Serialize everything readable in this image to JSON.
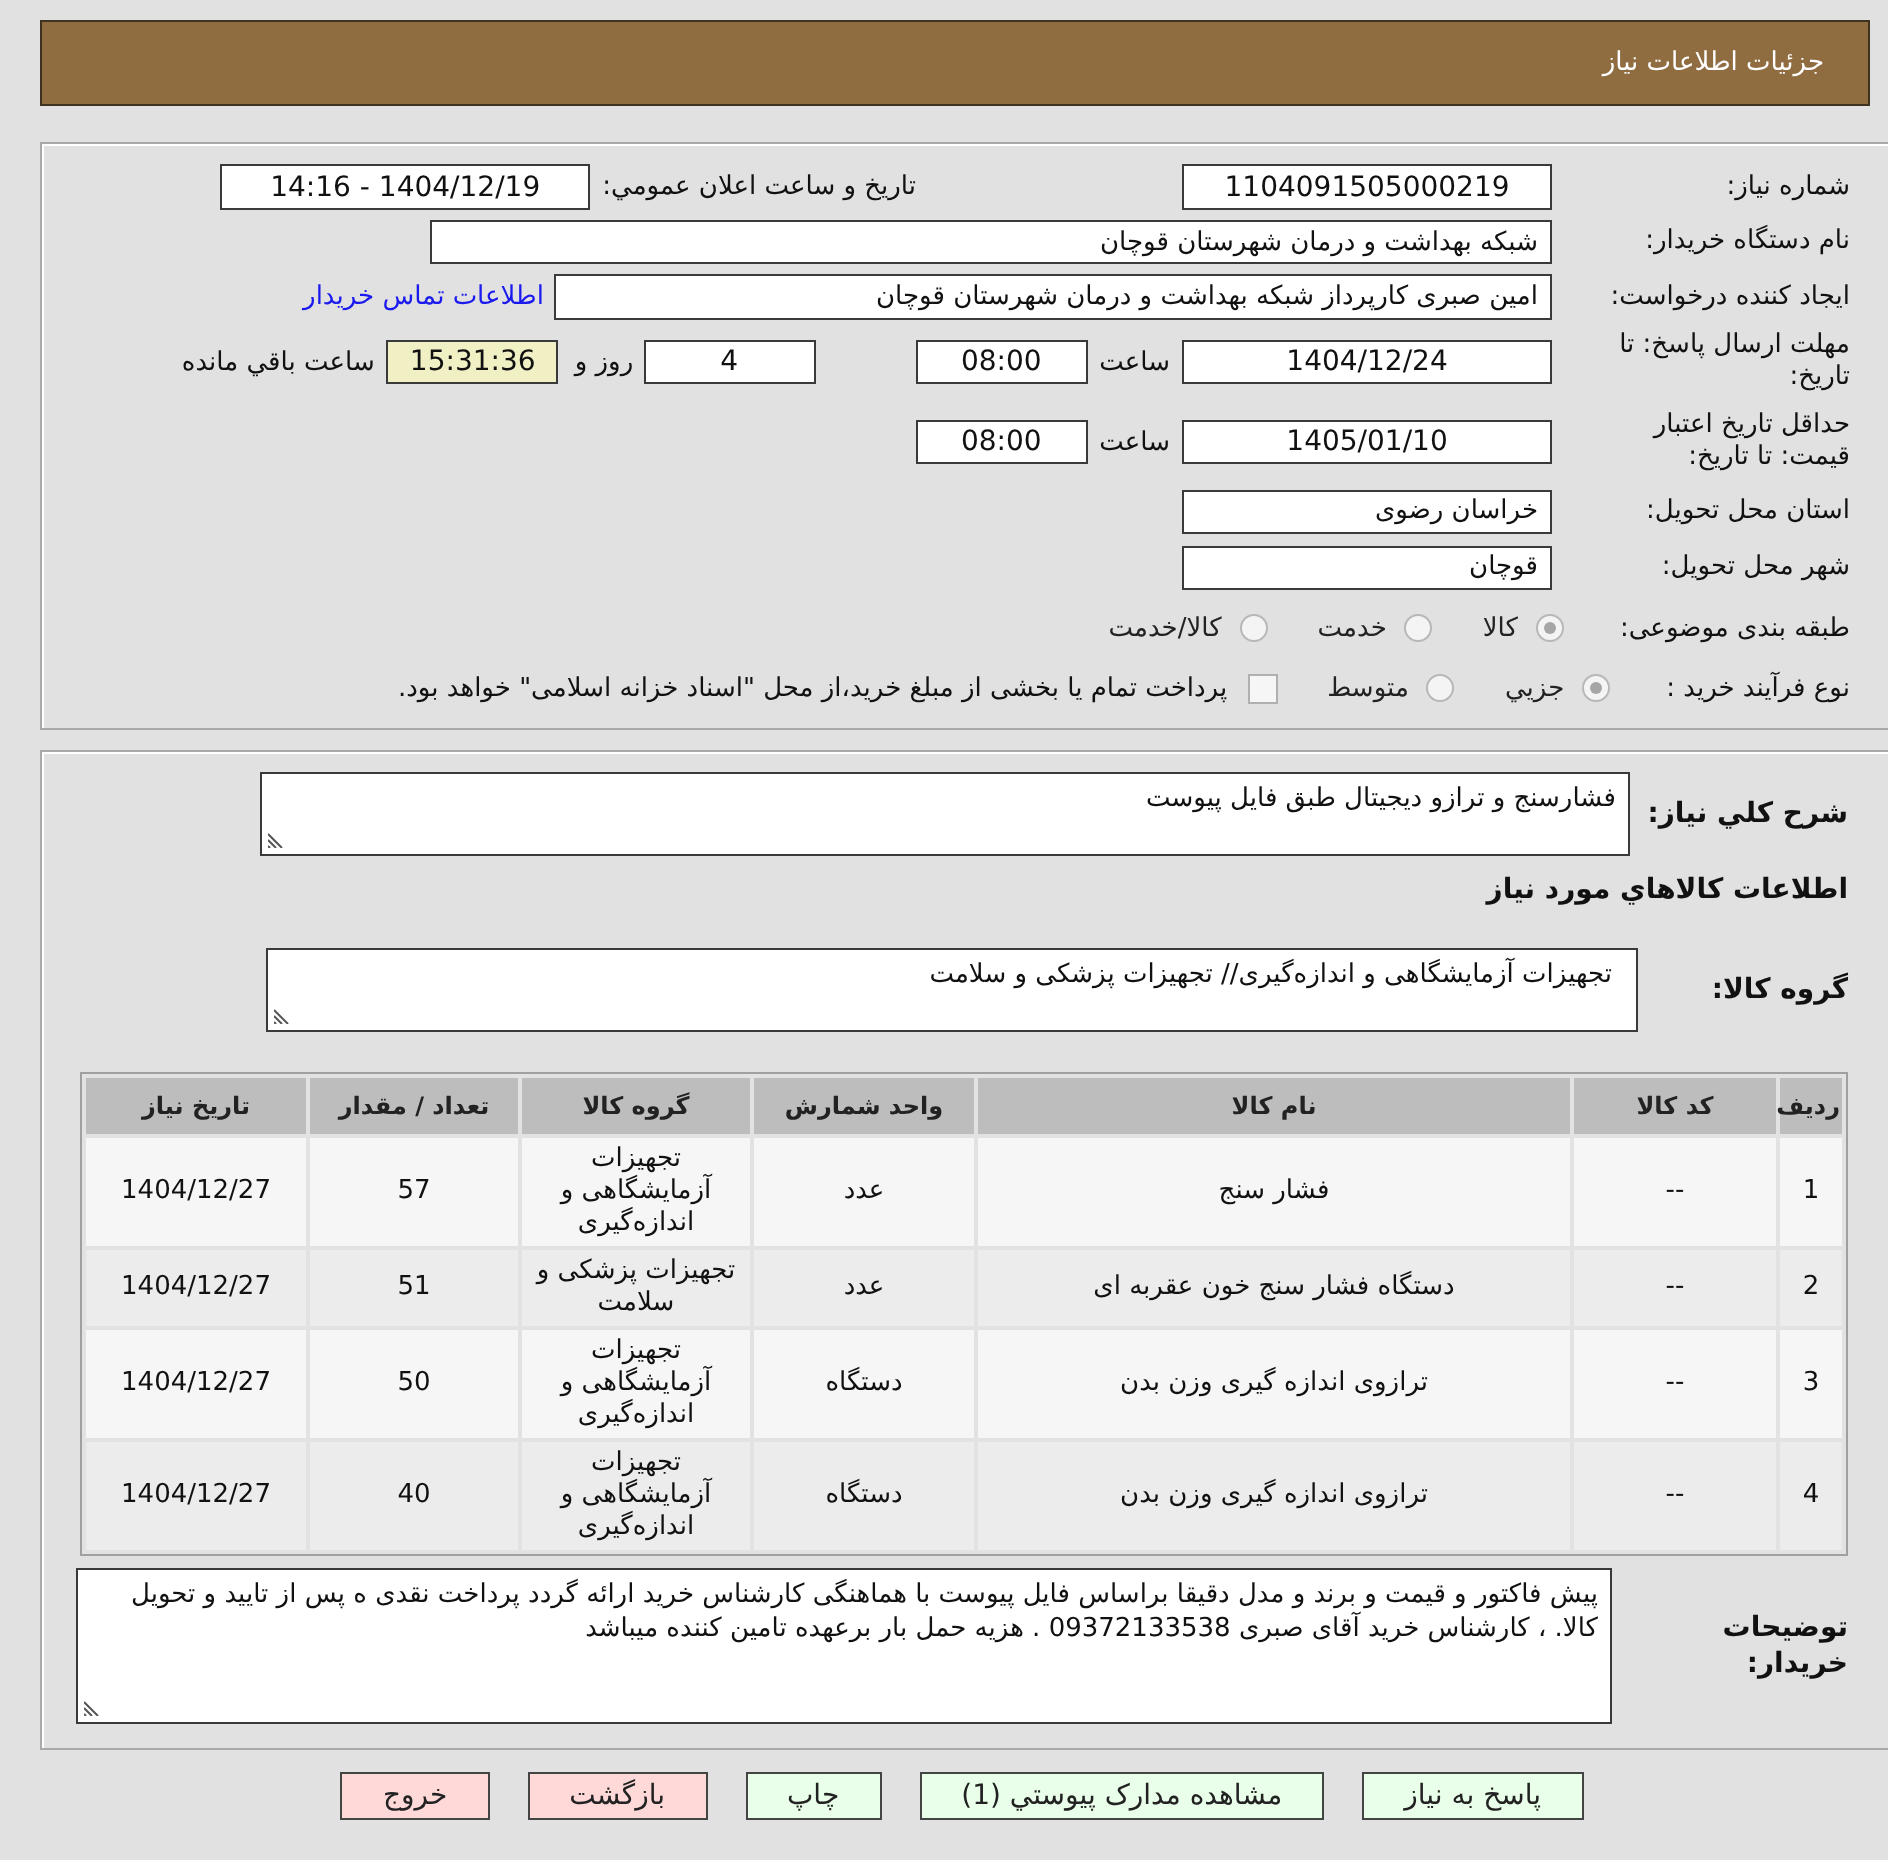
{
  "header": {
    "title": "جزئیات اطلاعات نیاز"
  },
  "need_info": {
    "need_number": {
      "label": "شماره نیاز:",
      "value": "1104091505000219"
    },
    "announce_datetime": {
      "label": "تاریخ و ساعت اعلان عمومي:",
      "value": "1404/12/19 - 14:16"
    },
    "buyer_org": {
      "label": "نام دستگاه خریدار:",
      "value": "شبکه بهداشت و درمان شهرستان قوچان"
    },
    "requester": {
      "label": "ایجاد کننده درخواست:",
      "value": "امین صبری کارپرداز شبکه بهداشت و درمان شهرستان قوچان",
      "link": "اطلاعات تماس خریدار"
    },
    "response_deadline": {
      "label": "مهلت ارسال پاسخ: تا تاریخ:",
      "date": "1404/12/24",
      "time_label": "ساعت",
      "time": "08:00",
      "days": "4",
      "days_label": "روز و",
      "remaining": "15:31:36",
      "remaining_label": "ساعت باقي مانده"
    },
    "price_validity": {
      "label": "حداقل تاریخ اعتبار قیمت: تا تاریخ:",
      "date": "1405/01/10",
      "time_label": "ساعت",
      "time": "08:00"
    },
    "province": {
      "label": "استان محل تحویل:",
      "value": "خراسان رضوی"
    },
    "city": {
      "label": "شهر محل تحویل:",
      "value": "قوچان"
    },
    "category": {
      "label": "طبقه بندی موضوعی:",
      "options": [
        {
          "label": "کالا",
          "selected": true
        },
        {
          "label": "خدمت",
          "selected": false
        },
        {
          "label": "کالا/خدمت",
          "selected": false
        }
      ]
    },
    "purchase_type": {
      "label": "نوع فرآیند خرید :",
      "options": [
        {
          "label": "جزيي",
          "selected": true
        },
        {
          "label": "متوسط",
          "selected": false
        }
      ],
      "treasury": {
        "label": "پرداخت تمام یا بخشی از مبلغ خرید،از محل \"اسناد خزانه اسلامی\" خواهد بود.",
        "checked": false
      }
    }
  },
  "items_info": {
    "description": {
      "label": "شرح كلي نیاز:",
      "value": "فشارسنج و ترازو دیجیتال طبق فایل پیوست"
    },
    "section_title": "اطلاعات كالاهاي مورد نیاز",
    "goods_group": {
      "label": "گروه کالا:",
      "value": "تجهیزات آزمایشگاهی و اندازه‌گیری// تجهیزات پزشکی و سلامت"
    },
    "table": {
      "columns": [
        "ردیف",
        "کد کالا",
        "نام کالا",
        "واحد شمارش",
        "گروه کالا",
        "تعداد / مقدار",
        "تاریخ نیاز"
      ],
      "rows": [
        [
          "1",
          "--",
          "فشار سنج",
          "عدد",
          "تجهیزات آزمایشگاهی و اندازه‌گیری",
          "57",
          "1404/12/27"
        ],
        [
          "2",
          "--",
          "دستگاه فشار سنج خون عقربه ای",
          "عدد",
          "تجهیزات پزشکی و سلامت",
          "51",
          "1404/12/27"
        ],
        [
          "3",
          "--",
          "ترازوی اندازه گیری وزن بدن",
          "دستگاه",
          "تجهیزات آزمایشگاهی و اندازه‌گیری",
          "50",
          "1404/12/27"
        ],
        [
          "4",
          "--",
          "ترازوی اندازه گیری وزن بدن",
          "دستگاه",
          "تجهیزات آزمایشگاهی و اندازه‌گیری",
          "40",
          "1404/12/27"
        ]
      ]
    },
    "buyer_notes": {
      "label": "توضیحات خریدار:",
      "value": "پیش فاکتور و قیمت و برند و مدل دقیقا براساس  فایل پیوست با هماهنگی کارشناس خرید ارائه گردد پرداخت نقدی ه پس از تایید  و تحویل کالا.  ، کارشناس خرید آقای صبری 09372133538 . هزیه حمل بار برعهده تامین کننده میباشد"
    }
  },
  "buttons": [
    {
      "label": "پاسخ به نیاز",
      "kind": "positive"
    },
    {
      "label": "مشاهده مدارک پیوستي (1)",
      "kind": "positive"
    },
    {
      "label": "چاپ",
      "kind": "positive"
    },
    {
      "label": "بازگشت",
      "kind": "negative"
    },
    {
      "label": "خروج",
      "kind": "negative"
    }
  ]
}
